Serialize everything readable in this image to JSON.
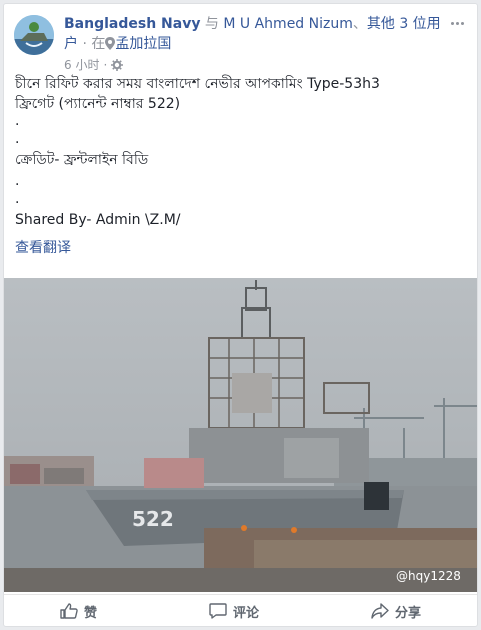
{
  "header": {
    "page_name": "Bangladesh Navy",
    "with_prefix": "与",
    "tagged_user": "M U Ahmed Nizum",
    "separator": "、",
    "others": "其他 3 位用户",
    "location_prefix": "· 在",
    "location": "孟加拉国",
    "time": "6 小时",
    "dot": "·"
  },
  "post": {
    "line1": "চীনে রিফিট করার সময় বাংলাদেশ নেভীর আপকামিং Type-53h3",
    "line2": "ফ্রিগেট (প্যানেন্ট নাম্বার 522)",
    "dot1": ".",
    "dot2": ".",
    "credit": "ক্রেডিট- ফ্রন্টলাইন বিডি",
    "dot3": ".",
    "dot4": ".",
    "shared_by": "Shared By- Admin \\Z.M/",
    "translate": "查看翻译"
  },
  "photo": {
    "hull_number": "522",
    "watermark": "@hqy1228"
  },
  "actions": {
    "like": "赞",
    "comment": "评论",
    "share": "分享"
  },
  "colors": {
    "link": "#365899",
    "meta": "#90949c",
    "text": "#1d2129"
  }
}
